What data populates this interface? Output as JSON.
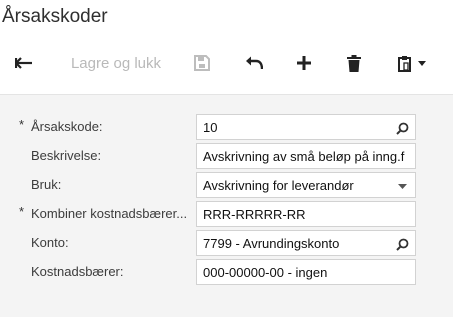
{
  "page": {
    "title": "Årsakskoder"
  },
  "toolbar": {
    "save_close_label": "Lagre og lukk"
  },
  "form": {
    "fields": [
      {
        "label": "Årsakskode:",
        "required": "*",
        "value": "10"
      },
      {
        "label": "Beskrivelse:",
        "required": "",
        "value": "Avskrivning av små beløp på inng.f"
      },
      {
        "label": "Bruk:",
        "required": "",
        "value": "Avskrivning for leverandør"
      },
      {
        "label": "Kombiner kostnadsbærer...",
        "required": "*",
        "value": "RRR-RRRRR-RR"
      },
      {
        "label": "Konto:",
        "required": "",
        "value": "7799 - Avrundingskonto"
      },
      {
        "label": "Kostnadsbærer:",
        "required": "",
        "value": "000-00000-00 - ingen"
      }
    ]
  },
  "icons": {
    "back": "arrow-left-icon",
    "save": "floppy-disk-icon",
    "undo": "undo-icon",
    "add": "plus-icon",
    "delete": "trash-icon",
    "paste": "clipboard-icon",
    "search": "search-icon",
    "dropdown": "chevron-down-icon"
  },
  "colors": {
    "panel_background": "#f4f4f4",
    "disabled_text": "#b9b9b9",
    "icon": "#222222"
  }
}
